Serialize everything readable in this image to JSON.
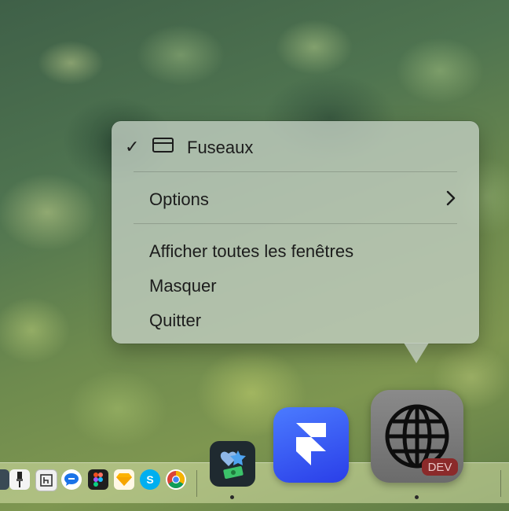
{
  "context_menu": {
    "app_window_item": {
      "checkmark": "✓",
      "label": "Fuseaux",
      "icon": "window-icon"
    },
    "options": {
      "label": "Options",
      "submenu_indicator": "chevron-right-icon"
    },
    "show_all_windows": {
      "label": "Afficher toutes les fenêtres"
    },
    "hide": {
      "label": "Masquer"
    },
    "quit": {
      "label": "Quitter"
    }
  },
  "dock": {
    "apps": [
      {
        "name": "app-partial",
        "icon": "partial-app-icon"
      },
      {
        "name": "app-brush",
        "icon": "brush-icon"
      },
      {
        "name": "app-hn",
        "icon": "h-square-icon"
      },
      {
        "name": "app-chat",
        "icon": "chat-bubble-icon"
      },
      {
        "name": "figma",
        "icon": "figma-icon"
      },
      {
        "name": "sketch",
        "icon": "sketch-diamond-icon"
      },
      {
        "name": "skype",
        "icon": "skype-icon",
        "letter": "S"
      },
      {
        "name": "chrome",
        "icon": "chrome-icon"
      },
      {
        "name": "app-heart-money",
        "icon": "heart-money-icon",
        "running": true
      },
      {
        "name": "framer",
        "icon": "framer-icon"
      },
      {
        "name": "fuseaux-dev",
        "icon": "globe-icon",
        "badge": "DEV",
        "running": true
      }
    ]
  },
  "colors": {
    "menu_text": "#1c1c1c",
    "framer_blue": "#3b5cf0",
    "dev_badge": "#8b2a2a"
  }
}
